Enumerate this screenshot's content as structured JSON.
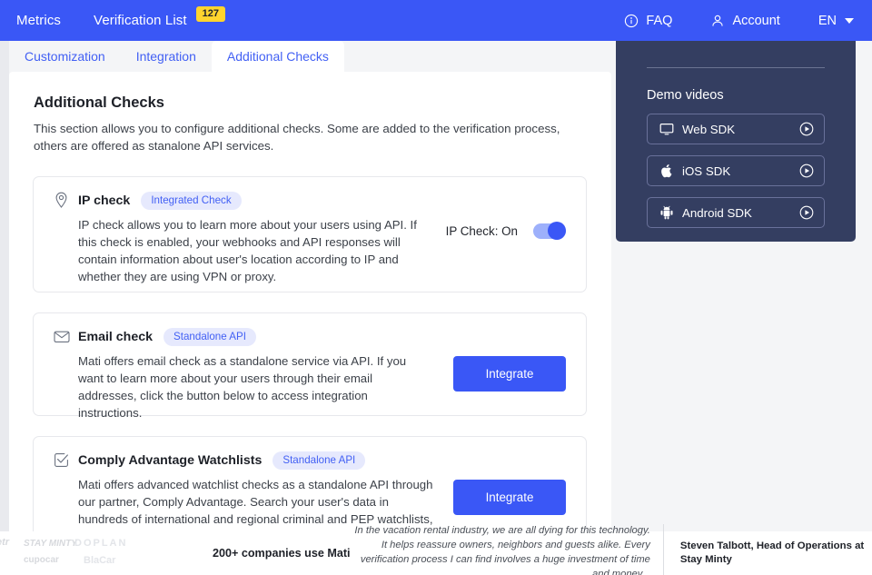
{
  "topnav": {
    "links": [
      {
        "label": "Metrics"
      },
      {
        "label": "Verification List",
        "badge": "127"
      }
    ],
    "right": [
      {
        "label": "FAQ",
        "icon": "info-icon"
      },
      {
        "label": "Account",
        "icon": "person-icon"
      },
      {
        "label": "EN",
        "icon": "chevron-down-icon"
      }
    ],
    "background": "#3A57F6",
    "badge_color": "#FFD42E"
  },
  "tabs": [
    {
      "label": "Customization",
      "active": false
    },
    {
      "label": "Integration",
      "active": false
    },
    {
      "label": "Additional Checks",
      "active": true
    }
  ],
  "section": {
    "title": "Additional Checks",
    "description": "This section allows you to configure additional checks. Some are added to the verification process, others are offered as stanalone API services."
  },
  "checks": [
    {
      "id": "ip-check",
      "icon": "location-pin-icon",
      "title": "IP check",
      "pill": "Integrated Check",
      "description": "IP check allows you to learn more about your users using API. If this check is enabled, your webhooks and API responses will contain information about user's location according to IP and whether they are using VPN or proxy.",
      "toggle_label": "IP Check: On",
      "toggle_on": true
    },
    {
      "id": "email-check",
      "icon": "envelope-icon",
      "title": "Email check",
      "pill": "Standalone API",
      "description": "Mati offers email check as a standalone service via API. If you want to learn more about your users through their email addresses, click the button below to access integration instructions.",
      "button_label": "Integrate"
    },
    {
      "id": "comply-advantage-watchlists",
      "icon": "checkbox-checked-icon",
      "title": "Comply Advantage Watchlists",
      "pill": "Standalone API",
      "description": "Mati offers advanced watchlist checks as a standalone API through our partner, Comply Advantage. Search your user's data in hundreds of international and regional criminal and PEP watchlists, ensure that your users are people you actually want to do business with. For detailed integration, instructions click on the button.",
      "button_label": "Integrate"
    }
  ],
  "sidebar": {
    "heading": "Demo videos",
    "background": "#343e61",
    "items": [
      {
        "label": "Web SDK",
        "icon": "monitor-icon",
        "action_icon": "play-icon"
      },
      {
        "label": "iOS SDK",
        "icon": "apple-icon",
        "action_icon": "play-icon"
      },
      {
        "label": "Android SDK",
        "icon": "android-icon",
        "action_icon": "play-icon"
      }
    ]
  },
  "footer": {
    "logos": [
      "etr",
      "STAY MINTY",
      "DOPLAN",
      "cupocar",
      "BlaCar"
    ],
    "companies_text": "200+ companies use Mati",
    "quote": "In the vacation rental industry, we are all dying for this technology. It helps reassure owners, neighbors and guests alike. Every verification process I can find involves a huge investment of time and money...",
    "author": "Steven Talbott, Head of Operations at Stay Minty"
  },
  "colors": {
    "brand_blue": "#3A57F6",
    "tab_blue": "#4260F4",
    "pill_bg": "#e6e9fd",
    "badge_yellow": "#FFD42E",
    "panel_navy": "#343e61"
  }
}
